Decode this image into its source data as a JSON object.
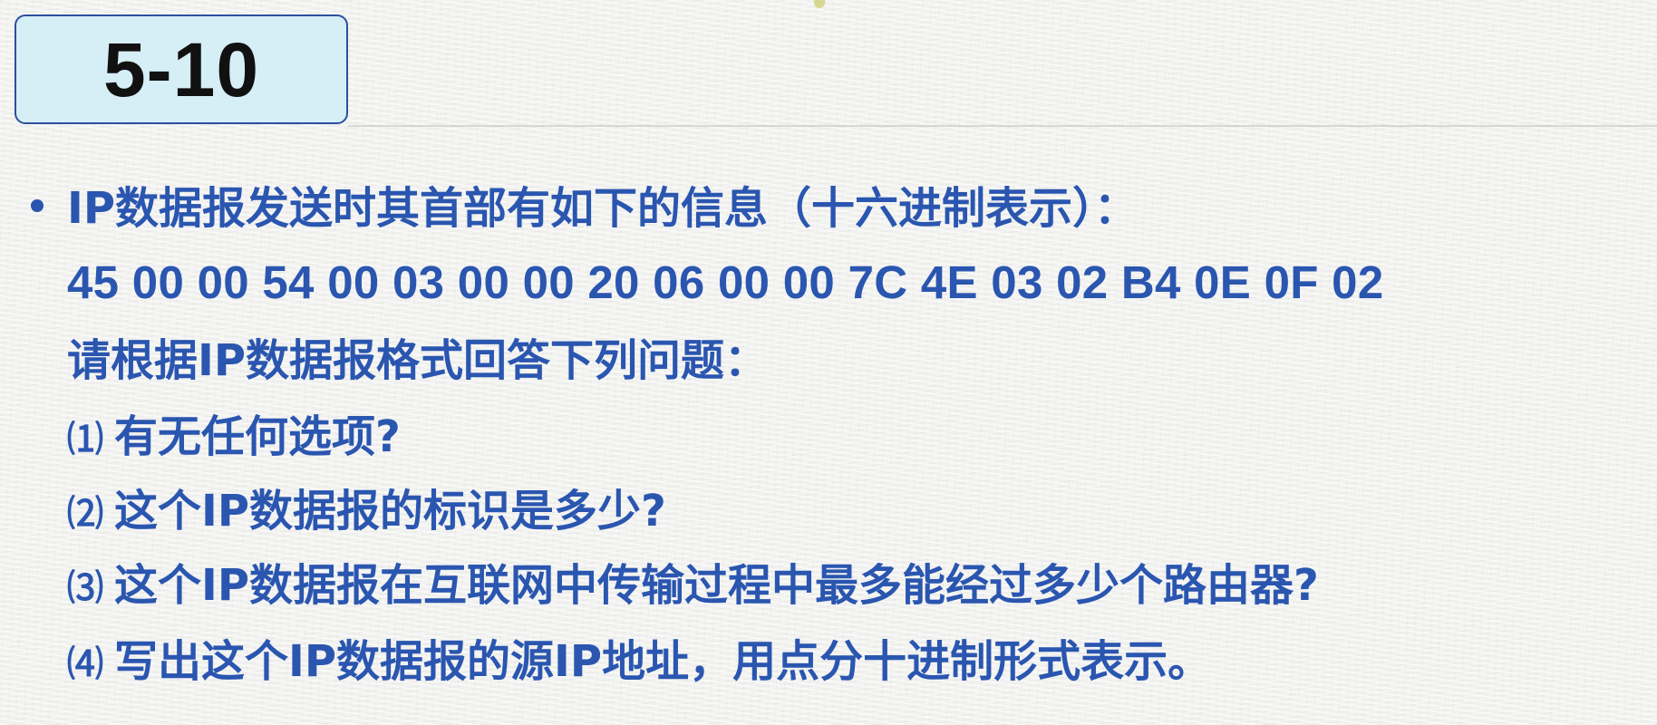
{
  "slide": {
    "title": "5-10",
    "intro": "IP数据报发送时其首部有如下的信息（十六进制表示）：",
    "hex_header": "45 00 00 54 00 03 00 00 20 06 00 00 7C 4E 03 02 B4 0E 0F 02",
    "instruction": "请根据IP数据报格式回答下列问题：",
    "questions": [
      {
        "number": "⑴",
        "text": "有无任何选项?"
      },
      {
        "number": "⑵",
        "text": "这个IP数据报的标识是多少?"
      },
      {
        "number": "⑶",
        "text": "这个IP数据报在互联网中传输过程中最多能经过多少个路由器?"
      },
      {
        "number": "⑷",
        "text": "写出这个IP数据报的源IP地址，用点分十进制形式表示。"
      }
    ]
  },
  "colors": {
    "text_blue": "#2a56b0",
    "title_box_fill": "#d6eef6",
    "title_box_border": "#2c4f9e",
    "title_text": "#111111"
  }
}
